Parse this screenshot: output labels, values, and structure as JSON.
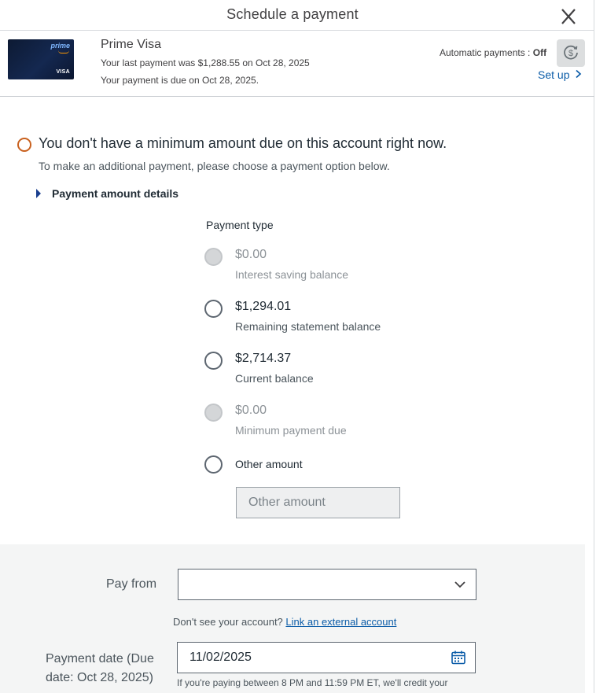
{
  "header": {
    "title": "Schedule a payment",
    "close_icon": "close-icon"
  },
  "account": {
    "card_brand_text": "prime",
    "card_network_text": "VISA",
    "name": "Prime Visa",
    "last_payment": "Your last payment was $1,288.55 on Oct 28, 2025",
    "due_text": "Your payment is due on Oct 28, 2025.",
    "auto_label": "Automatic payments :",
    "auto_status": "Off",
    "auto_icon": "autopay-dollar-icon",
    "setup_label": "Set up"
  },
  "notice": {
    "headline": "You don't have a minimum amount due on this account right now.",
    "subtext": "To make an additional payment, please choose a payment option below.",
    "details_label": "Payment amount details"
  },
  "payment_type": {
    "heading": "Payment type",
    "options": [
      {
        "amount": "$0.00",
        "description": "Interest saving balance",
        "disabled": true
      },
      {
        "amount": "$1,294.01",
        "description": "Remaining statement balance",
        "disabled": false
      },
      {
        "amount": "$2,714.37",
        "description": "Current balance",
        "disabled": false
      },
      {
        "amount": "$0.00",
        "description": "Minimum payment due",
        "disabled": true
      }
    ],
    "other_label": "Other amount",
    "other_placeholder": "Other amount"
  },
  "pay_from": {
    "label": "Pay from",
    "selected": "",
    "link_prompt": "Don't see your account?",
    "link_text": "Link an external account"
  },
  "payment_date": {
    "label": "Payment date (Due date: Oct 28, 2025)",
    "value": "11/02/2025",
    "note": "If you're paying between 8 PM and 11:59 PM ET, we'll credit your"
  },
  "colors": {
    "link": "#0b5ca8",
    "notice_ring": "#c9611f",
    "panel_bg": "#f4f5f5"
  }
}
